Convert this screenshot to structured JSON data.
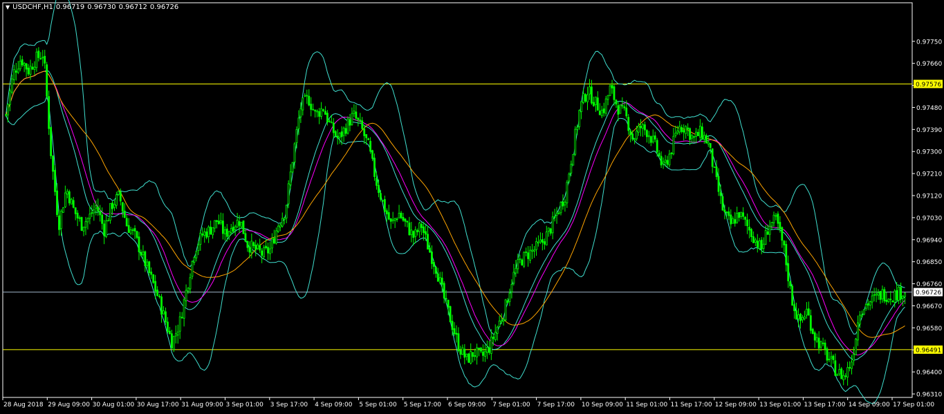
{
  "header": {
    "symbol": "USDCHF,H1",
    "open": "0.96719",
    "high": "0.96730",
    "low": "0.96712",
    "close": "0.96726"
  },
  "colors": {
    "background": "#000000",
    "frame": "#ffffff",
    "candle": "#00ff00",
    "bollinger": "#40e0d0",
    "ma_fast": "#ff00ff",
    "ma_slow": "#ffa500",
    "support_resistance": "#ffff00",
    "bid_line": "#9fb4c8",
    "text": "#ffffff"
  },
  "chart_data": {
    "type": "candlestick",
    "symbol": "USDCHF",
    "timeframe": "H1",
    "ylim": [
      0.9631,
      0.9782
    ],
    "y_ticks": [
      "0.97750",
      "0.97660",
      "0.97570",
      "0.97480",
      "0.97390",
      "0.97300",
      "0.97210",
      "0.97120",
      "0.97030",
      "0.96940",
      "0.96850",
      "0.96760",
      "0.96670",
      "0.96580",
      "0.96490",
      "0.96400",
      "0.96310"
    ],
    "x_ticks": [
      "28 Aug 2018",
      "29 Aug 09:00",
      "30 Aug 01:00",
      "30 Aug 17:00",
      "31 Aug 09:00",
      "3 Sep 01:00",
      "3 Sep 17:00",
      "4 Sep 09:00",
      "5 Sep 01:00",
      "5 Sep 17:00",
      "6 Sep 09:00",
      "7 Sep 01:00",
      "7 Sep 17:00",
      "10 Sep 09:00",
      "11 Sep 01:00",
      "11 Sep 17:00",
      "12 Sep 09:00",
      "13 Sep 01:00",
      "13 Sep 17:00",
      "14 Sep 09:00",
      "17 Sep 01:00"
    ],
    "horizontal_lines": [
      {
        "price": 0.97576,
        "label": "0.97576",
        "kind": "resistance"
      },
      {
        "price": 0.96491,
        "label": "0.96491",
        "kind": "support"
      }
    ],
    "bid": {
      "price": 0.96726,
      "label": "0.96726"
    },
    "price_path": [
      [
        0,
        0.9745
      ],
      [
        1,
        0.9762
      ],
      [
        2,
        0.9768
      ],
      [
        3,
        0.9763
      ],
      [
        4,
        0.9768
      ],
      [
        5,
        0.977
      ],
      [
        6,
        0.9728
      ],
      [
        7,
        0.97
      ],
      [
        8,
        0.9715
      ],
      [
        9,
        0.9706
      ],
      [
        10,
        0.97
      ],
      [
        11,
        0.9703
      ],
      [
        12,
        0.9708
      ],
      [
        13,
        0.9698
      ],
      [
        14,
        0.9708
      ],
      [
        15,
        0.9712
      ],
      [
        16,
        0.97
      ],
      [
        17,
        0.9696
      ],
      [
        18,
        0.9688
      ],
      [
        19,
        0.968
      ],
      [
        20,
        0.9672
      ],
      [
        21,
        0.9662
      ],
      [
        22,
        0.9652
      ],
      [
        23,
        0.966
      ],
      [
        24,
        0.9675
      ],
      [
        25,
        0.969
      ],
      [
        26,
        0.9696
      ],
      [
        27,
        0.9698
      ],
      [
        28,
        0.9702
      ],
      [
        29,
        0.9696
      ],
      [
        30,
        0.97
      ],
      [
        31,
        0.9702
      ],
      [
        32,
        0.9692
      ],
      [
        33,
        0.969
      ],
      [
        34,
        0.9688
      ],
      [
        35,
        0.969
      ],
      [
        36,
        0.97
      ],
      [
        37,
        0.9706
      ],
      [
        38,
        0.9728
      ],
      [
        39,
        0.9748
      ],
      [
        40,
        0.9752
      ],
      [
        41,
        0.9745
      ],
      [
        42,
        0.9748
      ],
      [
        43,
        0.974
      ],
      [
        44,
        0.9735
      ],
      [
        45,
        0.974
      ],
      [
        46,
        0.9745
      ],
      [
        47,
        0.974
      ],
      [
        48,
        0.9732
      ],
      [
        49,
        0.9718
      ],
      [
        50,
        0.9708
      ],
      [
        51,
        0.97
      ],
      [
        52,
        0.9705
      ],
      [
        53,
        0.97
      ],
      [
        54,
        0.9695
      ],
      [
        55,
        0.97
      ],
      [
        56,
        0.969
      ],
      [
        57,
        0.9682
      ],
      [
        58,
        0.967
      ],
      [
        59,
        0.966
      ],
      [
        60,
        0.965
      ],
      [
        61,
        0.9645
      ],
      [
        62,
        0.9648
      ],
      [
        63,
        0.9646
      ],
      [
        64,
        0.965
      ],
      [
        65,
        0.9658
      ],
      [
        66,
        0.9665
      ],
      [
        67,
        0.9678
      ],
      [
        68,
        0.9685
      ],
      [
        69,
        0.9688
      ],
      [
        70,
        0.969
      ],
      [
        71,
        0.9693
      ],
      [
        72,
        0.9698
      ],
      [
        73,
        0.9705
      ],
      [
        74,
        0.9712
      ],
      [
        75,
        0.973
      ],
      [
        76,
        0.9748
      ],
      [
        77,
        0.9755
      ],
      [
        78,
        0.975
      ],
      [
        79,
        0.9746
      ],
      [
        80,
        0.9756
      ],
      [
        81,
        0.9748
      ],
      [
        82,
        0.9745
      ],
      [
        83,
        0.9735
      ],
      [
        84,
        0.974
      ],
      [
        85,
        0.9738
      ],
      [
        86,
        0.9732
      ],
      [
        87,
        0.9723
      ],
      [
        88,
        0.973
      ],
      [
        89,
        0.974
      ],
      [
        90,
        0.974
      ],
      [
        91,
        0.9735
      ],
      [
        92,
        0.9738
      ],
      [
        93,
        0.9733
      ],
      [
        94,
        0.9718
      ],
      [
        95,
        0.9705
      ],
      [
        96,
        0.97
      ],
      [
        97,
        0.9705
      ],
      [
        98,
        0.97
      ],
      [
        99,
        0.9695
      ],
      [
        100,
        0.969
      ],
      [
        101,
        0.97
      ],
      [
        102,
        0.9702
      ],
      [
        103,
        0.969
      ],
      [
        104,
        0.967
      ],
      [
        105,
        0.966
      ],
      [
        106,
        0.9665
      ],
      [
        107,
        0.9655
      ],
      [
        108,
        0.965
      ],
      [
        109,
        0.9645
      ],
      [
        110,
        0.964
      ],
      [
        111,
        0.9638
      ],
      [
        112,
        0.9645
      ],
      [
        113,
        0.9665
      ],
      [
        114,
        0.9668
      ],
      [
        115,
        0.967
      ],
      [
        116,
        0.9672
      ],
      [
        117,
        0.9671
      ],
      [
        118,
        0.9672
      ],
      [
        119,
        0.9673
      ]
    ],
    "indicators": [
      "Bollinger Bands (20, 2)",
      "Moving Average (fast)",
      "Moving Average (slow)"
    ]
  }
}
